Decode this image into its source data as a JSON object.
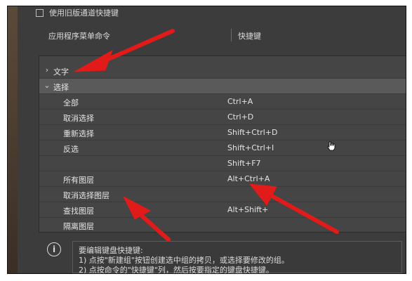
{
  "top_option": {
    "label": "使用旧版通道快捷键"
  },
  "header": {
    "col1": "应用程序菜单命令",
    "col2": "快捷键"
  },
  "tree": {
    "groups": [
      {
        "name": "文字",
        "expanded": false
      },
      {
        "name": "选择",
        "expanded": true
      }
    ],
    "items": [
      {
        "label": "全部",
        "shortcut": "Ctrl+A"
      },
      {
        "label": "取消选择",
        "shortcut": "Ctrl+D"
      },
      {
        "label": "重新选择",
        "shortcut": "Shift+Ctrl+D"
      },
      {
        "label": "反选",
        "shortcut": "Shift+Ctrl+I"
      },
      {
        "label": "",
        "shortcut": "Shift+F7"
      },
      {
        "label": "所有图层",
        "shortcut": "Alt+Ctrl+A"
      },
      {
        "label": "取消选择图层",
        "shortcut": ""
      },
      {
        "label": "查找图层",
        "shortcut": "Alt+Shift+"
      },
      {
        "label": "隔离图层",
        "shortcut": ""
      }
    ]
  },
  "info": {
    "line1": "要编辑键盘快捷键:",
    "line2": "1) 点按\"新建组\"按钮创建选中组的拷贝，或选择要修改的组。",
    "line3": "2) 点按命令的\"快捷键\"列，然后按要指定的键盘快捷键。"
  },
  "colors": {
    "panel_bg": "#3c3c3c",
    "arrow": "#e11a1a"
  }
}
